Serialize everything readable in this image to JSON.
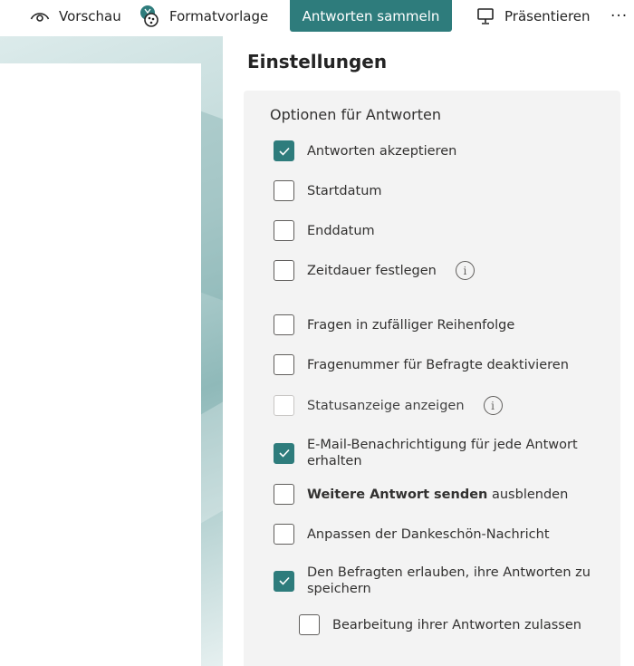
{
  "toolbar": {
    "preview_label": "Vorschau",
    "style_label": "Formatvorlage",
    "collect_label": "Antworten sammeln",
    "present_label": "Präsentieren",
    "more_label": "···",
    "accent_color": "#2e7c7c"
  },
  "settings": {
    "title": "Einstellungen",
    "section_title": "Optionen für Antworten",
    "options": [
      {
        "label": "Antworten akzeptieren",
        "checked": true
      },
      {
        "label": "Startdatum",
        "checked": false
      },
      {
        "label": "Enddatum",
        "checked": false
      },
      {
        "label": "Zeitdauer festlegen",
        "checked": false,
        "info_icon": "info-icon"
      },
      {
        "label": "Fragen in zufälliger Reihenfolge",
        "checked": false
      },
      {
        "label": "Fragenummer für Befragte deaktivieren",
        "checked": false
      },
      {
        "label": "Statusanzeige anzeigen",
        "checked": false,
        "disabled": true,
        "info_icon": "info-icon"
      },
      {
        "label": "E-Mail-Benachrichtigung für jede Antwort erhalten",
        "checked": true
      },
      {
        "label_bold": "Weitere Antwort senden",
        "label_rest": " ausblenden",
        "checked": false
      },
      {
        "label": "Anpassen der Dankeschön-Nachricht",
        "checked": false
      },
      {
        "label": "Den Befragten erlauben, ihre Antworten zu speichern",
        "checked": true
      },
      {
        "label": "Bearbeitung ihrer Antworten zulassen",
        "checked": false,
        "indented": true
      }
    ],
    "info_symbol": "i"
  }
}
